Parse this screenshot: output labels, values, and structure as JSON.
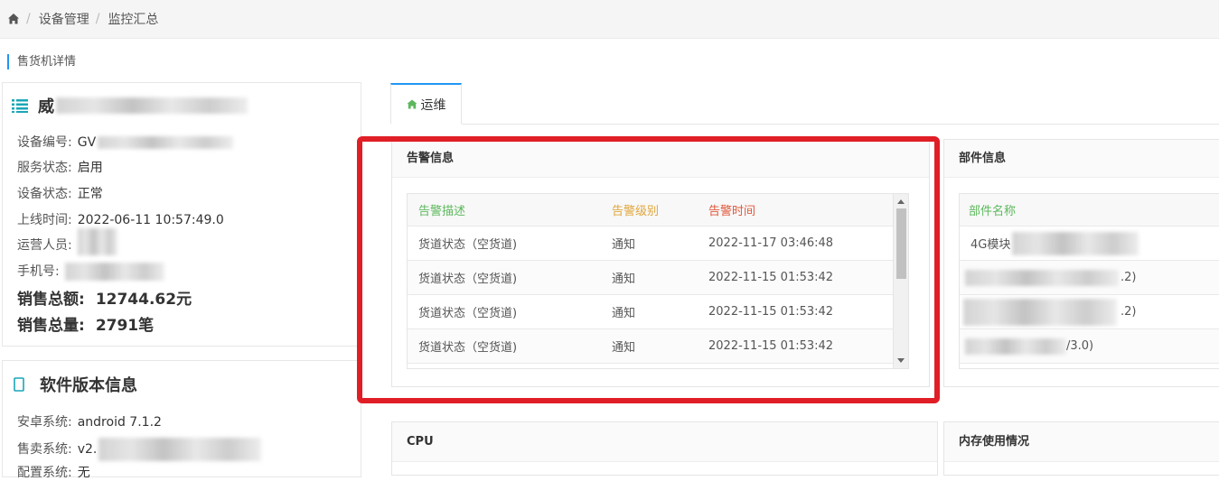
{
  "breadcrumb": {
    "items": [
      "设备管理",
      "监控汇总"
    ],
    "separator": "/"
  },
  "section_title": "售货机详情",
  "machine_card": {
    "name": "威",
    "fields": [
      {
        "label": "设备编号:",
        "value": "GV"
      },
      {
        "label": "服务状态:",
        "value": "启用"
      },
      {
        "label": "设备状态:",
        "value": "正常"
      },
      {
        "label": "上线时间:",
        "value": "2022-06-11 10:57:49.0"
      },
      {
        "label": "运营人员:",
        "value": ""
      },
      {
        "label": "手机号:",
        "value": ""
      }
    ],
    "sales_total_label": "销售总额:",
    "sales_total_value": "12744.62元",
    "sales_count_label": "销售总量:",
    "sales_count_value": "2791笔"
  },
  "software_card": {
    "title": "软件版本信息",
    "fields": [
      {
        "label": "安卓系统:",
        "value": "android 7.1.2"
      },
      {
        "label": "售卖系统:",
        "value": "v2."
      },
      {
        "label": "配置系统:",
        "value": "无"
      }
    ]
  },
  "tabs": [
    {
      "label": "运维",
      "icon": "home-icon",
      "active": true
    }
  ],
  "alert_panel": {
    "title": "告警信息",
    "columns": [
      "告警描述",
      "告警级别",
      "告警时间"
    ],
    "rows": [
      [
        "货道状态（空货道)",
        "通知",
        "2022-11-17 03:46:48"
      ],
      [
        "货道状态（空货道)",
        "通知",
        "2022-11-15 01:53:42"
      ],
      [
        "货道状态（空货道)",
        "通知",
        "2022-11-15 01:53:42"
      ],
      [
        "货道状态（空货道)",
        "通知",
        "2022-11-15 01:53:42"
      ]
    ]
  },
  "part_panel": {
    "title": "部件信息",
    "columns": [
      "部件名称"
    ],
    "rows": [
      "4G模块",
      ".2)",
      ".2)",
      "/3.0)"
    ]
  },
  "cpu_panel": {
    "title": "CPU"
  },
  "memory_panel": {
    "title": "内存使用情况"
  },
  "colors": {
    "accent": "#2196f3",
    "highlight": "#e01e26",
    "desc_header": "#5cb85c",
    "level_header": "#e0a63a",
    "time_header": "#e0573a"
  }
}
